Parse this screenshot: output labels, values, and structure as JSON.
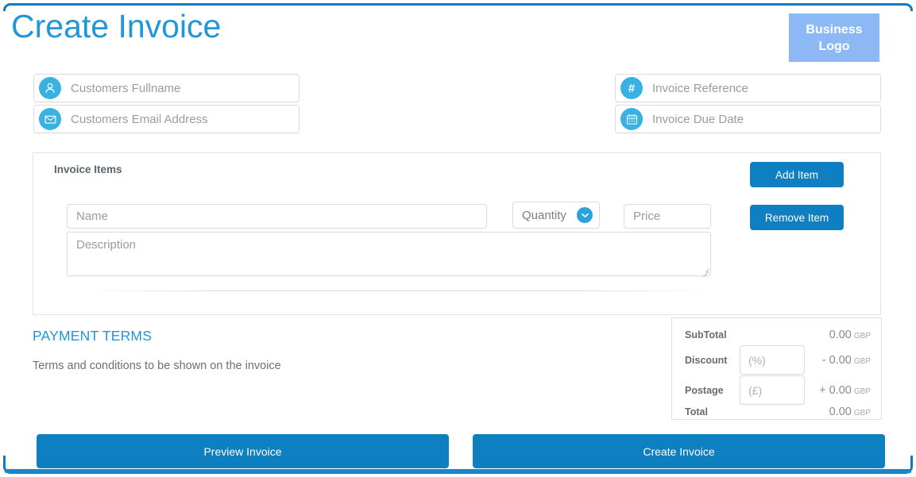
{
  "header": {
    "title": "Create Invoice",
    "logo_line1": "Business",
    "logo_line2": "Logo"
  },
  "customer_fields": [
    {
      "key": "fullname",
      "icon": "user-icon",
      "placeholder": "Customers Fullname"
    },
    {
      "key": "email",
      "icon": "envelope-icon",
      "placeholder": "Customers Email Address"
    }
  ],
  "invoice_fields": [
    {
      "key": "reference",
      "icon": "hash-icon",
      "placeholder": "Invoice Reference"
    },
    {
      "key": "due_date",
      "icon": "calendar-icon",
      "placeholder": "Invoice Due Date"
    }
  ],
  "items_panel": {
    "heading": "Invoice Items",
    "add_label": "Add Item",
    "remove_label": "Remove Item",
    "row": {
      "name_placeholder": "Name",
      "quantity_label": "Quantity",
      "price_placeholder": "Price",
      "description_placeholder": "Description"
    }
  },
  "payment_terms": {
    "title": "PAYMENT TERMS",
    "description": "Terms and conditions to be shown on the invoice"
  },
  "totals": {
    "currency": "GBP",
    "rows": [
      {
        "label": "SubTotal",
        "value": "0.00",
        "input": null
      },
      {
        "label": "Discount",
        "value": "- 0.00",
        "input": "(%)"
      },
      {
        "label": "Postage",
        "value": "+ 0.00",
        "input": "(£)"
      },
      {
        "label": "Total",
        "value": "0.00",
        "input": null
      }
    ]
  },
  "footer": {
    "preview_label": "Preview Invoice",
    "create_label": "Create Invoice"
  },
  "colors": {
    "frame_blue": "#1579bd",
    "title_blue": "#2196d8",
    "icon_blue": "#38b1e3",
    "button_blue": "#0e80c2",
    "logo_blue": "#8cb9f5"
  }
}
